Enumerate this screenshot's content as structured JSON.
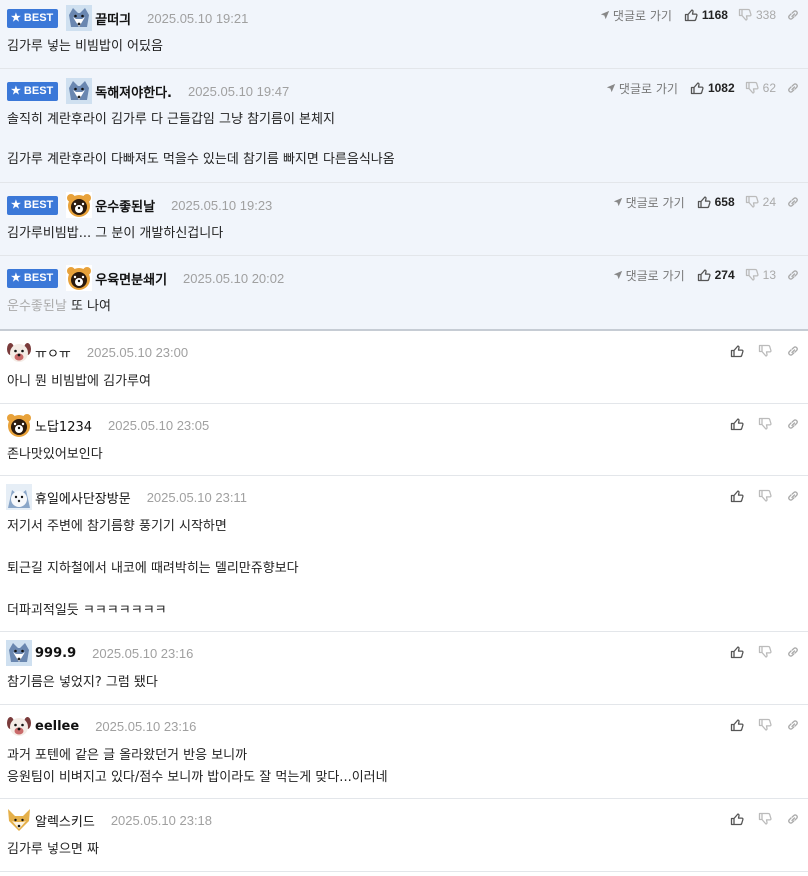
{
  "labels": {
    "best_badge": "BEST",
    "goto_reply": "댓글로 가기"
  },
  "colors": {
    "badge": "#3b78d8",
    "best_bg": "#f1f5fb"
  },
  "best_comments": [
    {
      "avatar": "wolf-avatar",
      "nick": "끝떠긔",
      "date": "2025.05.10 19:21",
      "likes": "1168",
      "dislikes": "338",
      "lines": [
        "김가루 넣는 비빔밥이 어딨음"
      ]
    },
    {
      "avatar": "wolf-avatar",
      "nick": "독해져야한다.",
      "date": "2025.05.10 19:47",
      "likes": "1082",
      "dislikes": "62",
      "lines": [
        "솔직히 계란후라이 김가루 다 근들갑임 그냥 참기름이 본체지",
        "김가루 계란후라이 다빠져도 먹을수 있는데 참기름 빠지면 다른음식나옴"
      ]
    },
    {
      "avatar": "bear-avatar",
      "nick": "운수좋된날",
      "date": "2025.05.10 19:23",
      "likes": "658",
      "dislikes": "24",
      "lines": [
        "김가루비빔밥... 그 분이 개발하신겁니다"
      ]
    },
    {
      "avatar": "bear-avatar",
      "nick": "우육면분쇄기",
      "date": "2025.05.10 20:02",
      "likes": "274",
      "dislikes": "13",
      "reply_to": "운수좋된날",
      "lines": [
        "또 나여"
      ]
    }
  ],
  "comments": [
    {
      "avatar": "dog-avatar",
      "nick": "ㅠㅇㅠ",
      "date": "2025.05.10 23:00",
      "lines": [
        "아니 뭔 비빔밥에 김가루여"
      ]
    },
    {
      "avatar": "bear-avatar",
      "nick": "노답1234",
      "date": "2025.05.10 23:05",
      "lines": [
        "존나맛있어보인다"
      ]
    },
    {
      "avatar": "seal-avatar",
      "nick": "휴일에사단장방문",
      "date": "2025.05.10 23:11",
      "lines": [
        "저기서 주변에 참기름향 풍기기 시작하면",
        "퇴근길 지하철에서 내코에 때려박히는 델리만쥬향보다",
        "더파괴적일듯 ㅋㅋㅋㅋㅋㅋㅋ"
      ]
    },
    {
      "avatar": "wolf-avatar",
      "nick": "999.9",
      "date": "2025.05.10 23:16",
      "lines": [
        "참기름은 넣었지? 그럼 됐다"
      ]
    },
    {
      "avatar": "dog-avatar",
      "nick": "eellee",
      "date": "2025.05.10 23:16",
      "lines": [
        "과거 포텐에 같은 글 올라왔던거 반응 보니까",
        "응원팀이 비벼지고 있다/점수 보니까 밥이라도 잘 먹는게 맞다...이러네"
      ]
    },
    {
      "avatar": "fox-avatar",
      "nick": "알렉스키드",
      "date": "2025.05.10 23:18",
      "lines": [
        "김가루 넣으면 짜"
      ]
    }
  ]
}
